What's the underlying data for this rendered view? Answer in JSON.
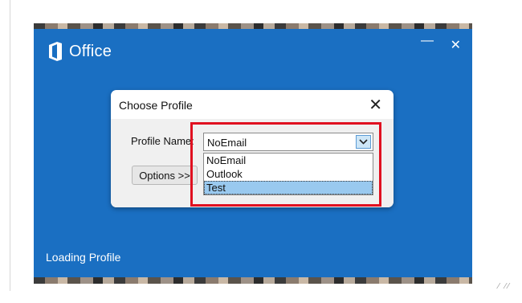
{
  "splash": {
    "brand": "Office",
    "minimize_glyph": "—",
    "close_glyph": "✕",
    "status": "Loading Profile",
    "background_color": "#1a6fc2"
  },
  "dialog": {
    "title": "Choose Profile",
    "close_glyph": "✕",
    "profile_label": "Profile Name:",
    "options_button": "Options >>",
    "combo": {
      "selected_value": "NoEmail",
      "options": [
        "NoEmail",
        "Outlook",
        "Test"
      ],
      "highlighted_option": "Test"
    }
  },
  "annotation": {
    "highlight_color": "#e01020"
  },
  "icons": [
    "office-logo-icon",
    "chevron-down-icon",
    "close-icon",
    "minimize-icon",
    "resize-grip-icon"
  ]
}
